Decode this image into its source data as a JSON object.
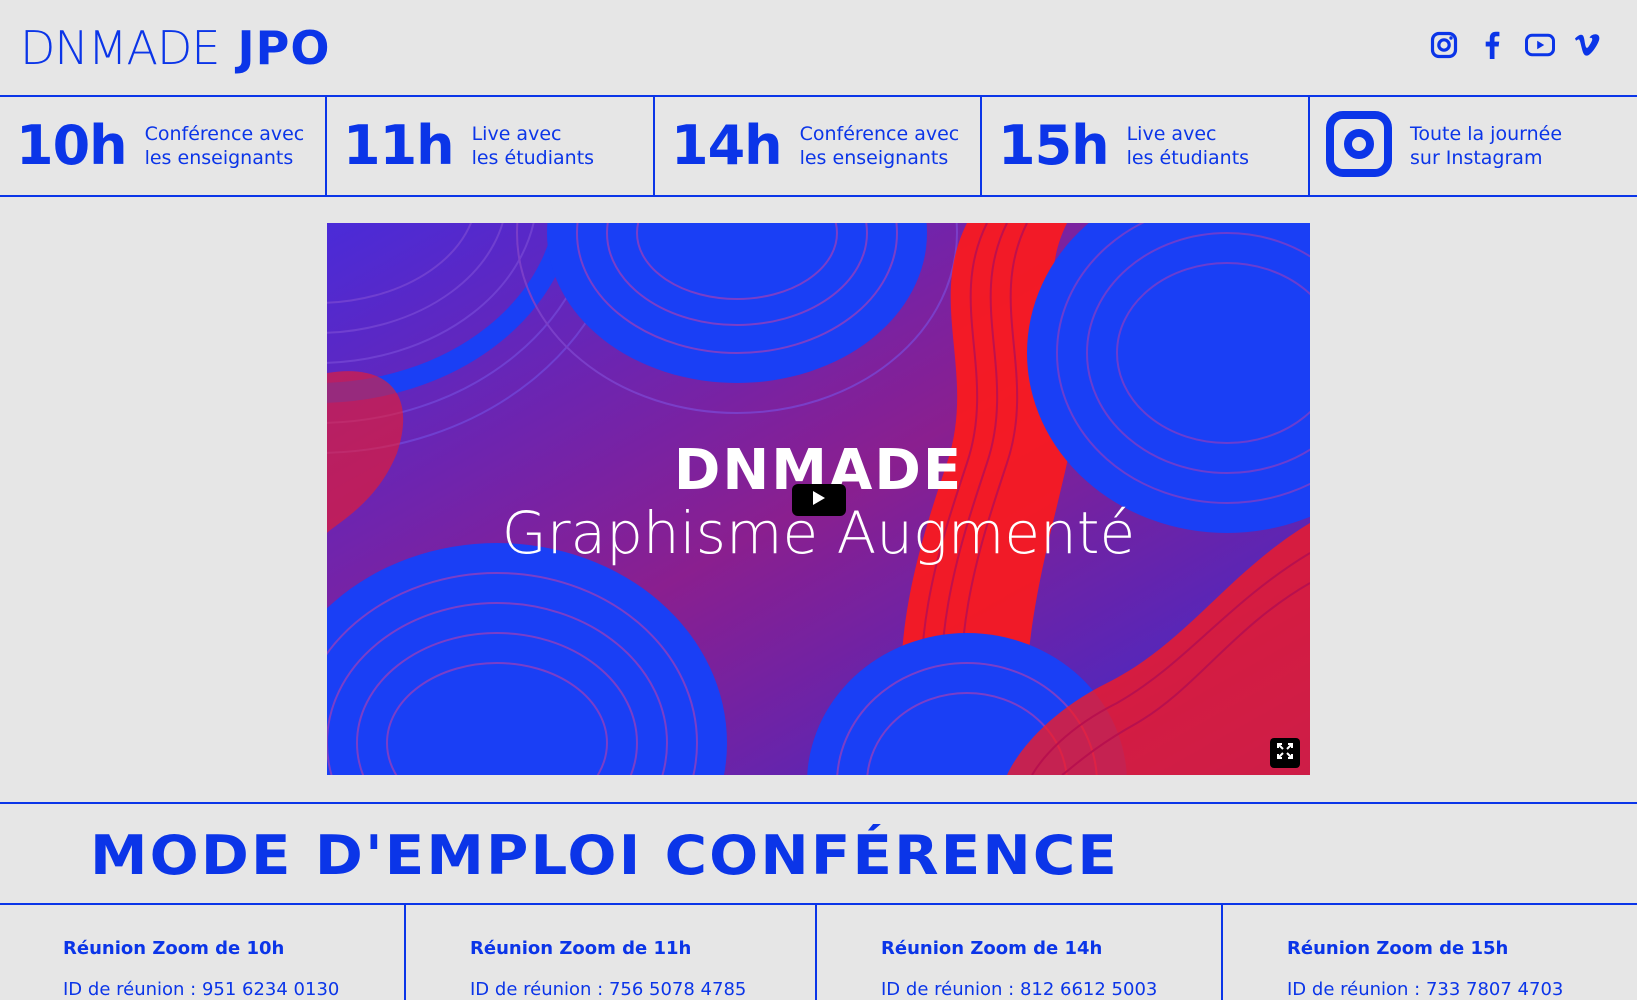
{
  "header": {
    "logo_main": "DNMADE",
    "logo_sub": "JPO",
    "socials": [
      {
        "icon": "instagram-icon"
      },
      {
        "icon": "facebook-icon"
      },
      {
        "icon": "youtube-icon"
      },
      {
        "icon": "vimeo-icon"
      }
    ]
  },
  "schedule": [
    {
      "time": "10h",
      "line1": "Conférence avec",
      "line2": "les enseignants"
    },
    {
      "time": "11h",
      "line1": "Live avec",
      "line2": "les étudiants"
    },
    {
      "time": "14h",
      "line1": "Conférence avec",
      "line2": "les enseignants"
    },
    {
      "time": "15h",
      "line1": "Live avec",
      "line2": "les étudiants"
    },
    {
      "icon": "instagram-icon",
      "line1": "Toute la journée",
      "line2": "sur Instagram"
    }
  ],
  "video": {
    "title": "DNMADE",
    "subtitle": "Graphisme Augmenté"
  },
  "section": {
    "title": "MODE D'EMPLOI CONFÉRENCE"
  },
  "meetings": [
    {
      "title": "Réunion Zoom de 10h",
      "id": "ID de réunion : 951 6234 0130"
    },
    {
      "title": "Réunion Zoom de 11h",
      "id": "ID de réunion : 756 5078 4785"
    },
    {
      "title": "Réunion Zoom de 14h",
      "id": "ID de réunion : 812 6612 5003"
    },
    {
      "title": "Réunion Zoom de 15h",
      "id": "ID de réunion : 733 7807 4703"
    }
  ],
  "colors": {
    "brand": "#0b35e8",
    "background": "#e6e6e6",
    "accent_red": "#ff1a1a"
  }
}
